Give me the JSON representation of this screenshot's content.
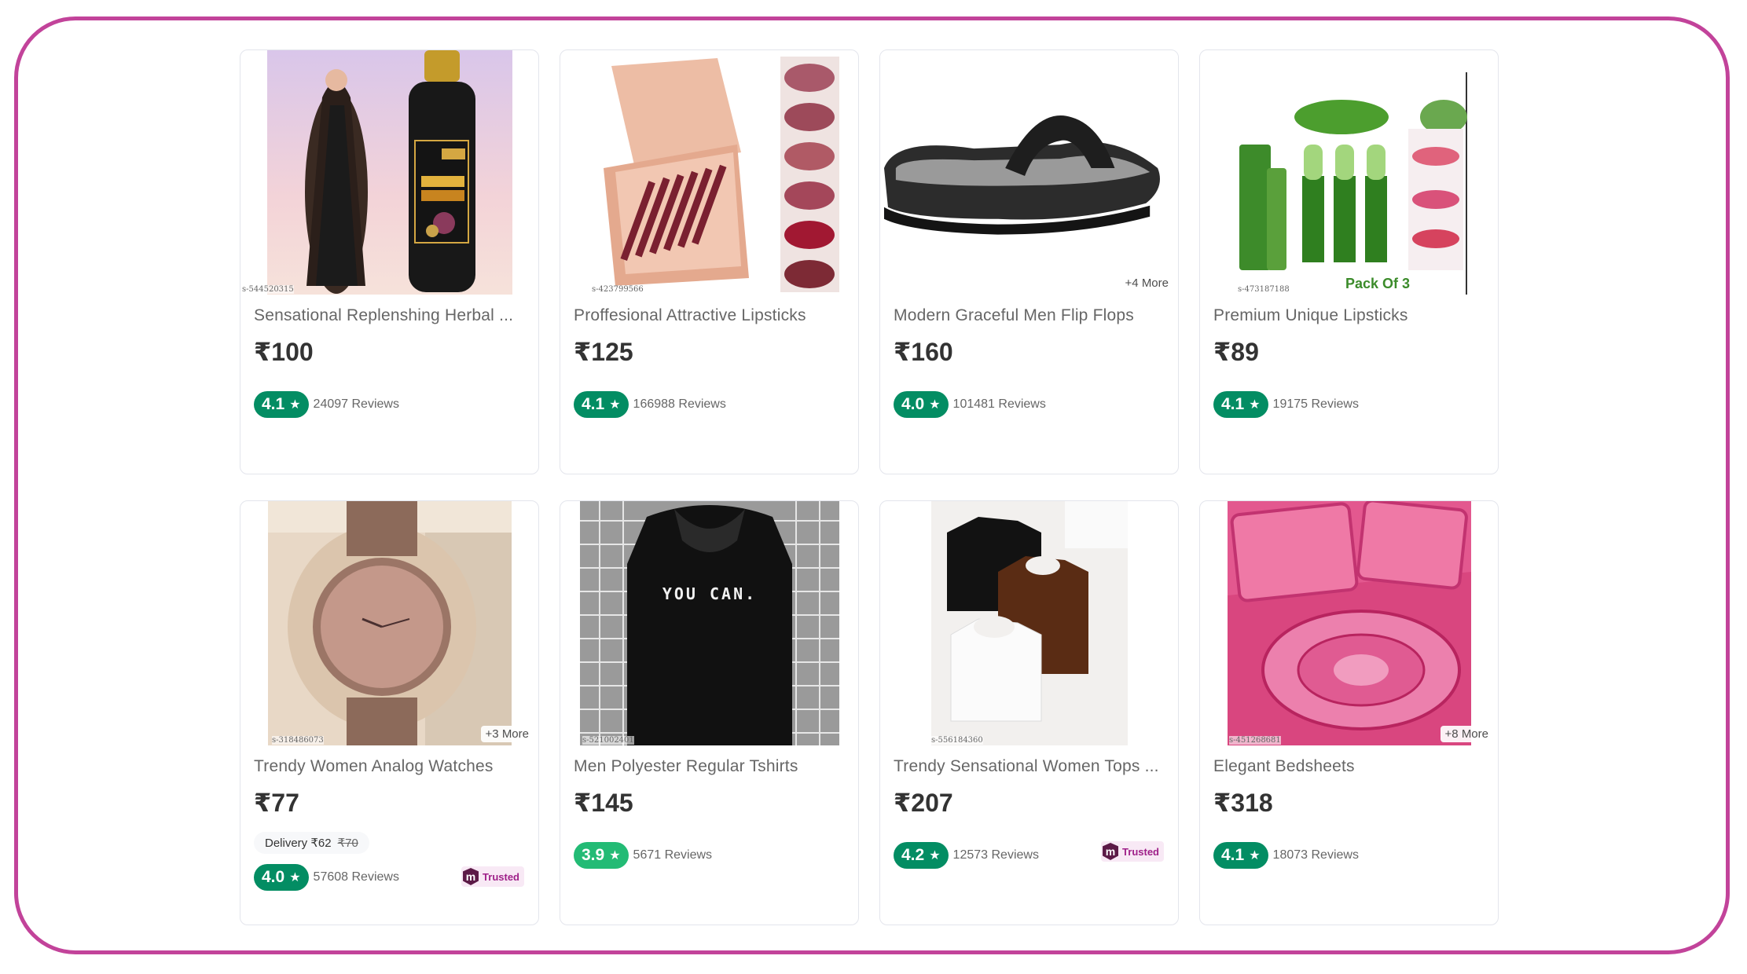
{
  "products": [
    {
      "title": "Sensational Replenshing Herbal ...",
      "price": "₹100",
      "rating": "4.1",
      "reviews": "24097 Reviews",
      "sku": "s-544520315",
      "more": "",
      "rating_color": "#038d63"
    },
    {
      "title": "Proffesional Attractive Lipsticks",
      "price": "₹125",
      "rating": "4.1",
      "reviews": "166988 Reviews",
      "sku": "s-423799566",
      "more": "",
      "rating_color": "#038d63"
    },
    {
      "title": "Modern Graceful Men Flip Flops",
      "price": "₹160",
      "rating": "4.0",
      "reviews": "101481 Reviews",
      "sku": "",
      "more": "+4 More",
      "rating_color": "#038d63"
    },
    {
      "title": "Premium Unique Lipsticks",
      "price": "₹89",
      "rating": "4.1",
      "reviews": "19175 Reviews",
      "sku": "s-473187188",
      "more": "",
      "image_caption": "Pack Of 3",
      "rating_color": "#038d63"
    },
    {
      "title": "Trendy Women Analog Watches",
      "price": "₹77",
      "rating": "4.0",
      "reviews": "57608 Reviews",
      "sku": "s-318486073",
      "more": "+3 More",
      "delivery": "Delivery ₹62",
      "delivery_strike": "₹70",
      "trusted": "Trusted",
      "rating_color": "#038d63"
    },
    {
      "title": "Men Polyester Regular Tshirts",
      "price": "₹145",
      "rating": "3.9",
      "reviews": "5671 Reviews",
      "sku": "s-521002401",
      "more": "",
      "image_caption": "YOU CAN.",
      "rating_color": "#23bb75"
    },
    {
      "title": "Trendy Sensational Women Tops ...",
      "price": "₹207",
      "rating": "4.2",
      "reviews": "12573 Reviews",
      "sku": "s-556184360",
      "more": "",
      "trusted": "Trusted",
      "rating_color": "#038d63"
    },
    {
      "title": "Elegant Bedsheets",
      "price": "₹318",
      "rating": "4.1",
      "reviews": "18073 Reviews",
      "sku": "s-451268681",
      "more": "+8 More",
      "rating_color": "#038d63"
    }
  ],
  "trusted_logo_letter": "m",
  "star_icon": "★",
  "colors": {
    "frame": "#c2439a",
    "rating_green": "#038d63",
    "rating_light_green": "#23bb75",
    "trusted_text": "#9f2089"
  }
}
